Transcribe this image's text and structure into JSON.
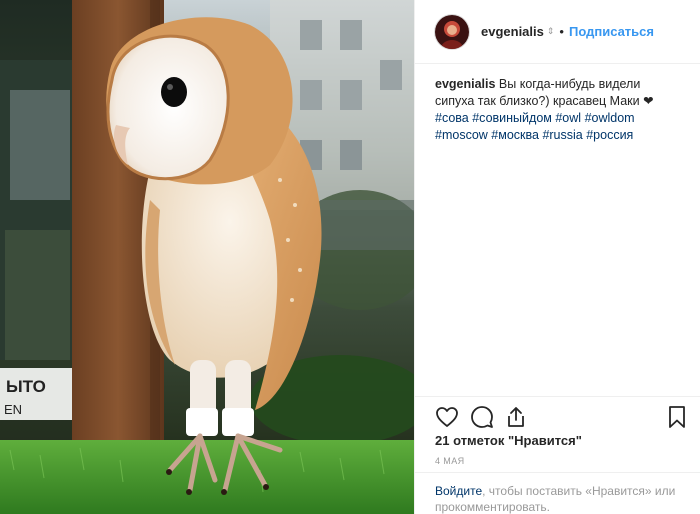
{
  "post": {
    "username": "evgenialis",
    "verified_glyph": "⇕",
    "separator": "•",
    "follow_label": "Подписаться",
    "image_alt": "Barn owl perched on artificial grass in front of a window"
  },
  "caption": {
    "username": "evgenialis",
    "text_1": " Вы когда-нибудь видели сипуха так близко?) красавец Маки ",
    "heart": "❤",
    "tags": [
      "#сова",
      "#совиныйдом",
      "#owl",
      "#owldom",
      "#moscow",
      "#москва",
      "#russia",
      "#россия"
    ]
  },
  "stats": {
    "likes": "21 отметок \"Нравится\"",
    "date": "4 МАЯ"
  },
  "login": {
    "link": "Войдите",
    "text": ", чтобы поставить «Нравится» или прокомментировать."
  },
  "photo_sign": {
    "line1": "ЫТО",
    "line2": "EN"
  },
  "icons": {
    "like": "heart-icon",
    "comment": "comment-icon",
    "share": "share-icon",
    "save": "bookmark-icon"
  },
  "colors": {
    "accent": "#3897f0",
    "hashtag": "#003569",
    "muted": "#999999",
    "text": "#262626",
    "border": "#efefef"
  }
}
